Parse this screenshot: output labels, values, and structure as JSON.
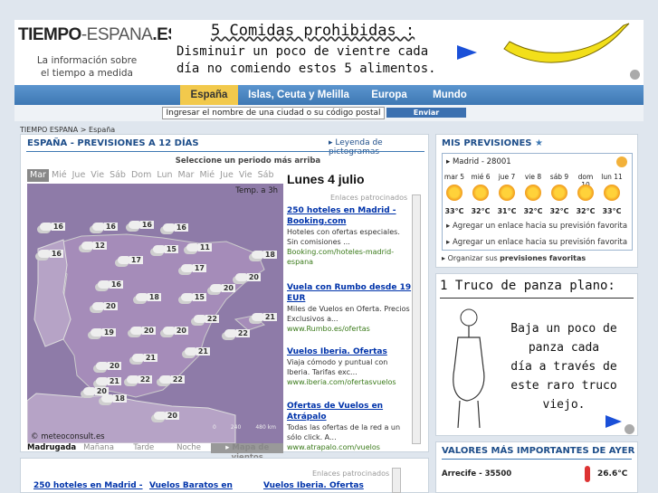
{
  "header": {
    "logo_part1": "TIEMPO",
    "logo_part2": "-ESPANA",
    "logo_part3": ".ES",
    "tagline_line1": "La información sobre",
    "tagline_line2": "el tiempo a medida"
  },
  "top_ad": {
    "title": "5 Comidas prohibidas :",
    "line1": "Disminuir un poco de vientre cada",
    "line2": "día no comiendo estos 5 alimentos."
  },
  "nav": {
    "items": [
      "España",
      "Islas, Ceuta y Melilla",
      "Europa",
      "Mundo"
    ],
    "active": "España"
  },
  "search": {
    "placeholder": "Ingresar el nombre de una ciudad o su código postal",
    "button": "Enviar"
  },
  "breadcrumb": "TIEMPO ESPANA > España",
  "forecast": {
    "title": "ESPAÑA - PREVISIONES A 12 DÍAS",
    "legend_link": "Leyenda de pictogramas",
    "select_hint": "Seleccione un periodo más arriba",
    "days": [
      "Mar",
      "Mié",
      "Jue",
      "Vie",
      "Sáb",
      "Dom",
      "Lun",
      "Mar",
      "Mié",
      "Jue",
      "Vie",
      "Sáb"
    ],
    "active_day": "Mar",
    "map_temp_label": "Temp. a 3h",
    "map_credit": "© meteoconsult.es",
    "scale": [
      "0",
      "240",
      "480 km"
    ],
    "temps": [
      "16",
      "16",
      "16",
      "16",
      "16",
      "12",
      "17",
      "15",
      "11",
      "17",
      "18",
      "16",
      "18",
      "15",
      "20",
      "20",
      "20",
      "21",
      "22",
      "19",
      "20",
      "20",
      "21",
      "22",
      "21",
      "20",
      "22",
      "22",
      "21",
      "20",
      "18",
      "20"
    ],
    "times": [
      "Madrugada",
      "Mañana",
      "Tarde",
      "Noche"
    ],
    "active_time": "Madrugada",
    "wind_map": "Mapa de vientos"
  },
  "side_ads": {
    "date": "Lunes 4 julio",
    "label": "Enlaces patrocinados",
    "ads": [
      {
        "title": "250 hoteles en Madrid - Booking.com",
        "desc": "Hoteles con ofertas especiales. Sin comisiones ...",
        "url": "Booking.com/hoteles-madrid-espana"
      },
      {
        "title": "Vuela con Rumbo desde 19 EUR",
        "desc": "Miles de Vuelos en Oferta. Precios Exclusivos a...",
        "url": "www.Rumbo.es/ofertas"
      },
      {
        "title": "Vuelos Iberia. Ofertas",
        "desc": "Viaja cómodo y puntual con Iberia. Tarifas exc...",
        "url": "www.iberia.com/ofertasvuelos"
      },
      {
        "title": "Ofertas de Vuelos en Atrápalo",
        "desc": "Todas las ofertas de la red a un sólo click. A...",
        "url": "www.atrapalo.com/vuelos"
      }
    ]
  },
  "my_forecasts": {
    "title": "MIS PREVISIONES",
    "city": "Madrid - 28001",
    "days": [
      "mar 5",
      "mié 6",
      "jue 7",
      "vie 8",
      "sáb 9",
      "dom 10",
      "lun 11"
    ],
    "temps": [
      "33°C",
      "32°C",
      "31°C",
      "32°C",
      "32°C",
      "32°C",
      "33°C"
    ],
    "link1": "Agregar un enlace hacia su previsión favorita",
    "link2": "Agregar un enlace hacia su previsión favorita",
    "organize_prefix": "Organizar sus ",
    "organize_link": "previsiones favoritas"
  },
  "right_ad": {
    "title": "1 Truco de panza plano:",
    "body1": "Baja un poco de",
    "body2": "panza cada",
    "body3": "día a través de",
    "body4": "este raro truco",
    "body5": "viejo."
  },
  "yesterday": {
    "title": "VALORES MÁS IMPORTANTES DE AYER",
    "city": "Arrecife - 35500",
    "temp": "26.6°C"
  },
  "bottom_ads": {
    "label": "Enlaces patrocinados",
    "items": [
      "250 hoteles en Madrid -",
      "Vuelos Baratos en",
      "Vuelos Iberia. Ofertas"
    ]
  }
}
